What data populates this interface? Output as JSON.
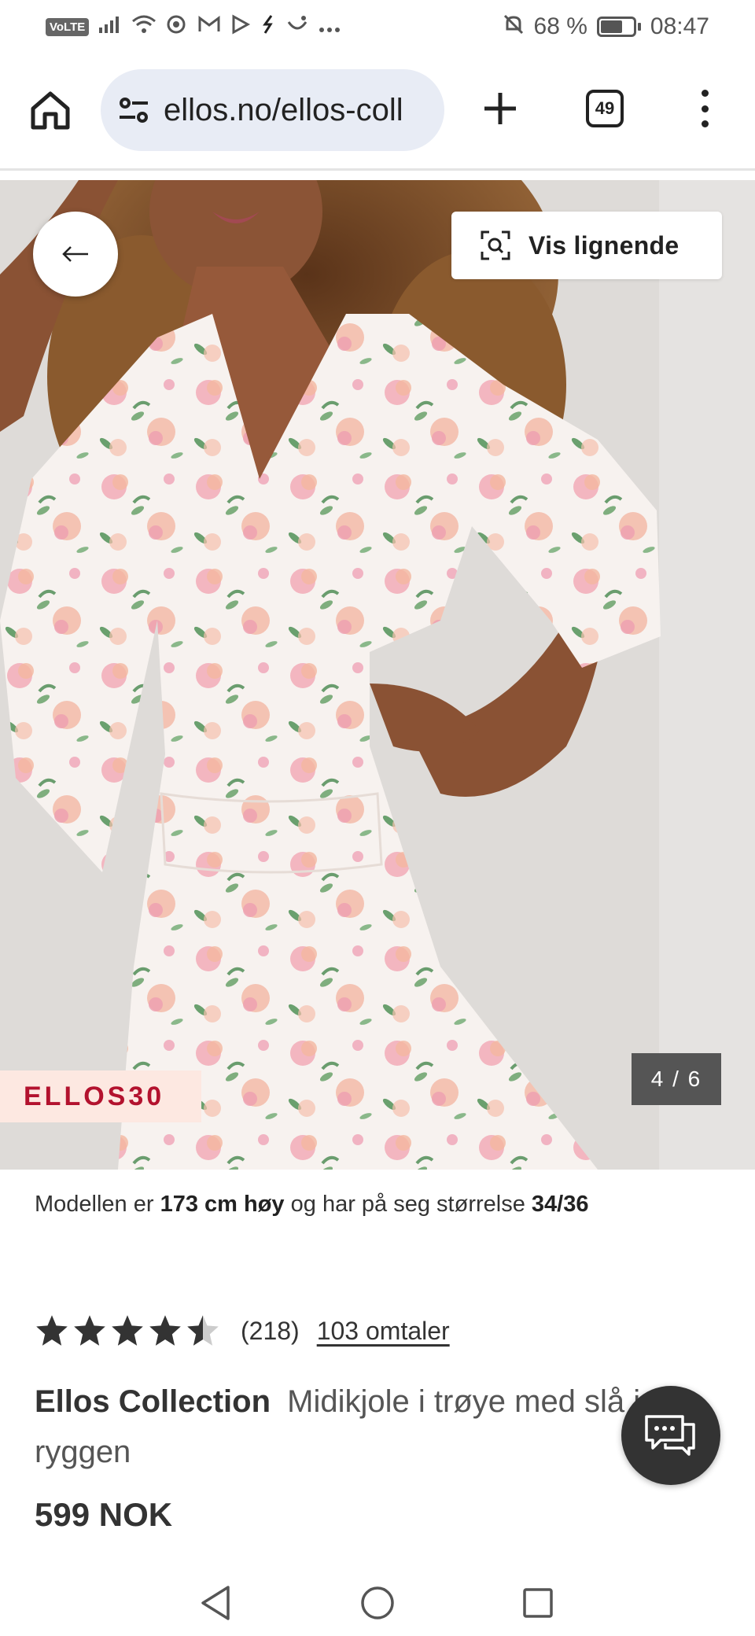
{
  "status_bar": {
    "network_badge": "VoLTE",
    "signal": "",
    "battery_percent": "68 %",
    "battery_level": 0.68,
    "time": "08:47"
  },
  "browser": {
    "url": "ellos.no/ellos-coll",
    "tab_count": "49"
  },
  "gallery": {
    "similar_button_label": "Vis lignende",
    "promo_code": "ELLOS30",
    "page_counter": "4 / 6",
    "current_image": 4,
    "total_images": 6
  },
  "model_info": {
    "prefix": "Modellen er ",
    "height": "173 cm høy",
    "middle": " og har på seg størrelse ",
    "size": "34/36"
  },
  "rating": {
    "stars": 4.5,
    "max_stars": 5,
    "count": "(218)",
    "reviews_link": "103 omtaler"
  },
  "product": {
    "brand": "Ellos Collection",
    "name": "Midikjole i trøye med slå i ryggen",
    "price": "599 NOK"
  },
  "icons": {
    "home": "home-icon",
    "site_settings": "tune-icon",
    "new_tab": "plus-icon",
    "menu": "more-vert-icon",
    "back": "arrow-left-icon",
    "visual_search": "lens-icon",
    "chat": "chat-icon"
  },
  "colors": {
    "url_bar_bg": "#e8ecf5",
    "promo_bg": "#fde8e1",
    "promo_text": "#b3122e",
    "counter_bg": "#555555",
    "chat_bg": "#333333"
  }
}
